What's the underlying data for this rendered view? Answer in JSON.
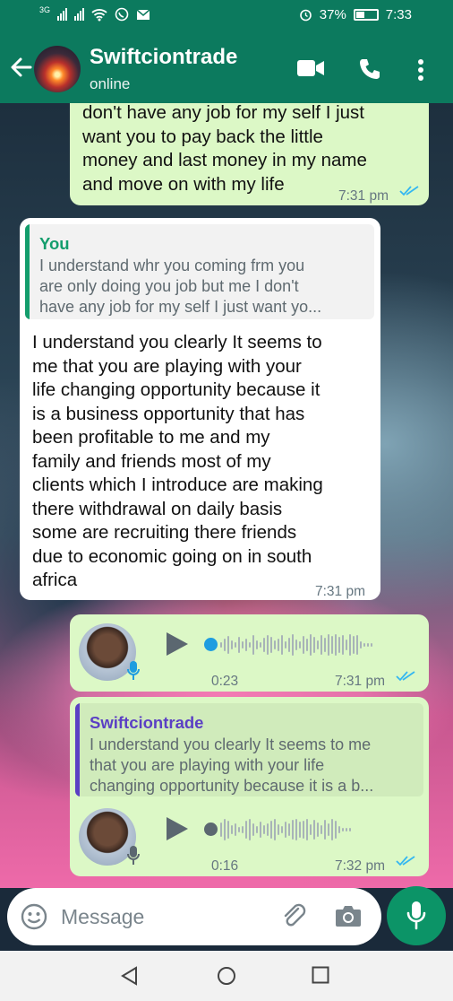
{
  "status_bar": {
    "network_label": "3G",
    "battery_percent": "37%",
    "time": "7:33"
  },
  "header": {
    "contact_name": "Swiftciontrade",
    "contact_status": "online"
  },
  "messages": [
    {
      "direction": "outgoing",
      "text": "don't have any job for my self I just\nwant you to pay back the little\nmoney and last money in my name\nand move on with my life",
      "time": "7:31 pm",
      "read": true
    },
    {
      "direction": "incoming",
      "quote": {
        "author": "You",
        "text": "I understand whr you coming frm you\nare only doing you job but me I don't\nhave any job for my self I just want yo..."
      },
      "text": "I understand you clearly It seems to\nme that you are playing with your\nlife changing opportunity because it\nis a business opportunity that has\nbeen profitable to me and my\nfamily and friends most of my\nclients which I introduce are making\nthere withdrawal on daily basis\nsome are recruiting there friends\ndue to economic going on in south\nafrica",
      "time": "7:31 pm"
    },
    {
      "direction": "outgoing",
      "type": "voice",
      "duration": "0:23",
      "time": "7:31 pm",
      "read": true,
      "progress": 0
    },
    {
      "direction": "outgoing",
      "type": "voice",
      "quote": {
        "author": "Swiftciontrade",
        "text": "I understand you clearly It seems to me\nthat you are playing with your life\nchanging opportunity because it is a b..."
      },
      "duration": "0:16",
      "time": "7:32 pm",
      "read": true,
      "progress": 0
    }
  ],
  "input": {
    "placeholder": "Message"
  },
  "colors": {
    "brand": "#0c7a5e",
    "outgoing_bubble": "#dcf8c6",
    "incoming_bubble": "#ffffff",
    "read_ticks": "#34b7f1",
    "you_quote": "#139d6c",
    "contact_quote": "#5b3fc4",
    "voice_dot_played": "#1e9de0",
    "voice_dot_unplayed": "#5b6770"
  },
  "icons": {
    "header": [
      "back-arrow-icon",
      "video-call-icon",
      "voice-call-icon",
      "more-options-icon"
    ],
    "input": [
      "emoji-icon",
      "attach-icon",
      "camera-icon",
      "mic-icon"
    ],
    "nav": [
      "back-triangle-icon",
      "home-circle-icon",
      "recents-square-icon"
    ]
  }
}
